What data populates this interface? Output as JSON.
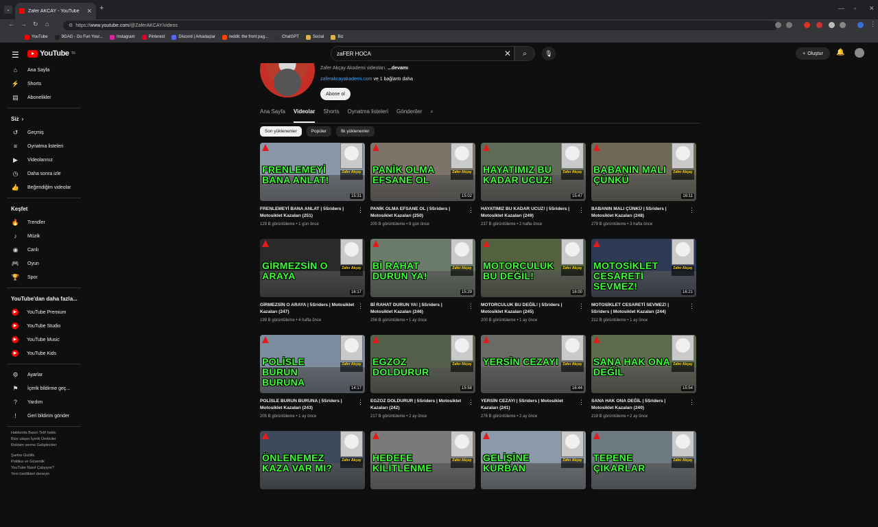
{
  "browser": {
    "tab_title": "Zafer AKCAY - YouTube",
    "url_scheme": "https://",
    "url_host": "www.youtube.com",
    "url_path": "/@ZaferAKCAY/videos",
    "bookmarks": [
      {
        "label": "YouTube",
        "color": "#ff0000"
      },
      {
        "label": "9GAG - Go Fun Your...",
        "color": "#222222"
      },
      {
        "label": "Instagram",
        "color": "#d6249f"
      },
      {
        "label": "Pinterest",
        "color": "#e60023"
      },
      {
        "label": "Discord | Arkadaşlar",
        "color": "#5865f2"
      },
      {
        "label": "reddit: the front pag...",
        "color": "#ff4500"
      },
      {
        "label": "ChatGPT",
        "color": "#333333"
      },
      {
        "label": "Social",
        "color": "#e0b24b"
      },
      {
        "label": "Biz",
        "color": "#e0b24b"
      }
    ]
  },
  "header": {
    "logo": "YouTube",
    "region": "TR",
    "search_value": "zaFER HOCA",
    "create_label": "Oluştur"
  },
  "sidebar": {
    "main": [
      {
        "label": "Ana Sayfa",
        "icon": "⌂"
      },
      {
        "label": "Shorts",
        "icon": "⚡"
      },
      {
        "label": "Abonelikler",
        "icon": "▤"
      }
    ],
    "you_heading": "Siz",
    "you": [
      {
        "label": "Geçmiş",
        "icon": "↺"
      },
      {
        "label": "Oynatma listeleri",
        "icon": "≡"
      },
      {
        "label": "Videolarınız",
        "icon": "▶"
      },
      {
        "label": "Daha sonra izle",
        "icon": "◷"
      },
      {
        "label": "Beğendiğim videolar",
        "icon": "👍"
      }
    ],
    "explore_heading": "Keşfet",
    "explore": [
      {
        "label": "Trendler",
        "icon": "🔥"
      },
      {
        "label": "Müzik",
        "icon": "♪"
      },
      {
        "label": "Canlı",
        "icon": "◉"
      },
      {
        "label": "Oyun",
        "icon": "🎮"
      },
      {
        "label": "Spor",
        "icon": "🏆"
      }
    ],
    "more_heading": "YouTube'dan daha fazla...",
    "more": [
      {
        "label": "YouTube Premium"
      },
      {
        "label": "YouTube Studio"
      },
      {
        "label": "YouTube Music"
      },
      {
        "label": "YouTube Kids"
      }
    ],
    "settings": [
      {
        "label": "Ayarlar",
        "icon": "⚙"
      },
      {
        "label": "İçerik bildirme geç...",
        "icon": "⚑"
      },
      {
        "label": "Yardım",
        "icon": "?"
      },
      {
        "label": "Geri bildirim gönder",
        "icon": "!"
      }
    ],
    "footer1": "Hakkında  Basın  Telif hakkı",
    "footer2": "Bize ulaşın  İçerik Üreticiler",
    "footer3": "Reklam verme  Geliştiriciler",
    "footer4": "Şartlar  Gizlilik",
    "footer5": "Politika ve Güvenlik",
    "footer6": "YouTube Nasıl Çalışıyor?",
    "footer7": "Yeni özellikleri deneyin"
  },
  "channel": {
    "desc": "Zafer Akçay Akademi videoları.",
    "more": "...devamı",
    "link": "zaferakcayakademi.com",
    "link_more": "ve 1 bağlantı daha",
    "subscribe": "Abone ol",
    "tabs": [
      "Ana Sayfa",
      "Videolar",
      "Shorts",
      "Oynatma listeleri",
      "Gönderiler"
    ],
    "chips": [
      "Son yüklenenler",
      "Popüler",
      "İlk yüklenenler"
    ]
  },
  "videos": [
    {
      "title": "FRENLEMEYİ BANA ANLAT | 5Sriders | Motosiklet Kazaları (251)",
      "meta": "129 B görüntüleme • 1 gün önce",
      "dur": "15:31",
      "ov": "FRENLEMEYİ BANA ANLAT!",
      "bg": "#8a97a8"
    },
    {
      "title": "PANİK OLMA EFSANE OL | 5Sriders | Motosiklet Kazaları (250)",
      "meta": "200 B görüntüleme • 8 gün önce",
      "dur": "15:02",
      "ov": "PANİK OLMA EFSANE OL",
      "bg": "#7c7468"
    },
    {
      "title": "HAYATIMIZ BU KADAR UCUZ! | 5Sriders | Motosiklet Kazaları (249)",
      "meta": "237 B görüntüleme • 2 hafta önce",
      "dur": "15:47",
      "ov": "HAYATIMIZ BU KADAR UCUZ!",
      "bg": "#5f6a57"
    },
    {
      "title": "BABANIN MALI ÇÜNKÜ | 5Sriders | Motosiklet Kazaları (248)",
      "meta": "279 B görüntüleme • 3 hafta önce",
      "dur": "16:11",
      "ov": "BABANIN MALI ÇÜNKÜ",
      "bg": "#6e6a55"
    },
    {
      "title": "GİRMEZSİN O ARAYA | 5Sriders | Motosiklet Kazaları (247)",
      "meta": "199 B görüntüleme • 4 hafta önce",
      "dur": "16:17",
      "ov": "GİRMEZSİN O ARAYA",
      "bg": "#2a2a2a"
    },
    {
      "title": "Bİ RAHAT DURUN YA! | 5Sriders | Motosiklet Kazaları (246)",
      "meta": "256 B görüntüleme • 1 ay önce",
      "dur": "15:29",
      "ov": "Bİ RAHAT DURUN YA!",
      "bg": "#6b7b6a"
    },
    {
      "title": "MOTORCULUK BU DEĞİL! | 5Sriders | Motosiklet Kazaları (245)",
      "meta": "200 B görüntüleme • 1 ay önce",
      "dur": "16:00",
      "ov": "MOTORCULUK BU DEĞİL!",
      "bg": "#54613f"
    },
    {
      "title": "MOTOSİKLET CESARETİ SEVMEZ! | 5Sriders | Motosiklet Kazaları (244)",
      "meta": "212 B görüntüleme • 1 ay önce",
      "dur": "16:21",
      "ov": "MOTOSİKLET CESARETİ SEVMEZ!",
      "bg": "#2f3a55"
    },
    {
      "title": "POLİSLE BURUN BURUNA | 5Sriders | Motosiklet Kazaları (243)",
      "meta": "205 B görüntüleme • 1 ay önce",
      "dur": "14:17",
      "ov": "POLİSLE BURUN BURUNA",
      "bg": "#7c8da0"
    },
    {
      "title": "EGZOZ DOLDURUR | 5Sriders | Motosiklet Kazaları (242)",
      "meta": "217 B görüntüleme • 2 ay önce",
      "dur": "15:58",
      "ov": "EGZOZ DOLDURUR",
      "bg": "#55604a"
    },
    {
      "title": "YERSİN CEZAYI | 5Sriders | Motosiklet Kazaları (241)",
      "meta": "276 B görüntüleme • 2 ay önce",
      "dur": "16:44",
      "ov": "YERSİN CEZAYI",
      "bg": "#6a6a66"
    },
    {
      "title": "SANA HAK ONA DEĞİL | 5Sriders | Motosiklet Kazaları (240)",
      "meta": "219 B görüntüleme • 2 ay önce",
      "dur": "15:54",
      "ov": "SANA HAK ONA DEĞİL",
      "bg": "#5d6b4f"
    },
    {
      "title": "",
      "meta": "",
      "dur": "",
      "ov": "ÖNLENEMEZ KAZA VAR MI?",
      "bg": "#3e4a5a"
    },
    {
      "title": "",
      "meta": "",
      "dur": "",
      "ov": "HEDEFE KİLİTLENME",
      "bg": "#7a7a7a"
    },
    {
      "title": "",
      "meta": "",
      "dur": "",
      "ov": "GELİŞİNE KURBAN",
      "bg": "#8a9aa8"
    },
    {
      "title": "",
      "meta": "",
      "dur": "",
      "ov": "TEPENE ÇIKARLAR",
      "bg": "#6d7a82"
    }
  ]
}
